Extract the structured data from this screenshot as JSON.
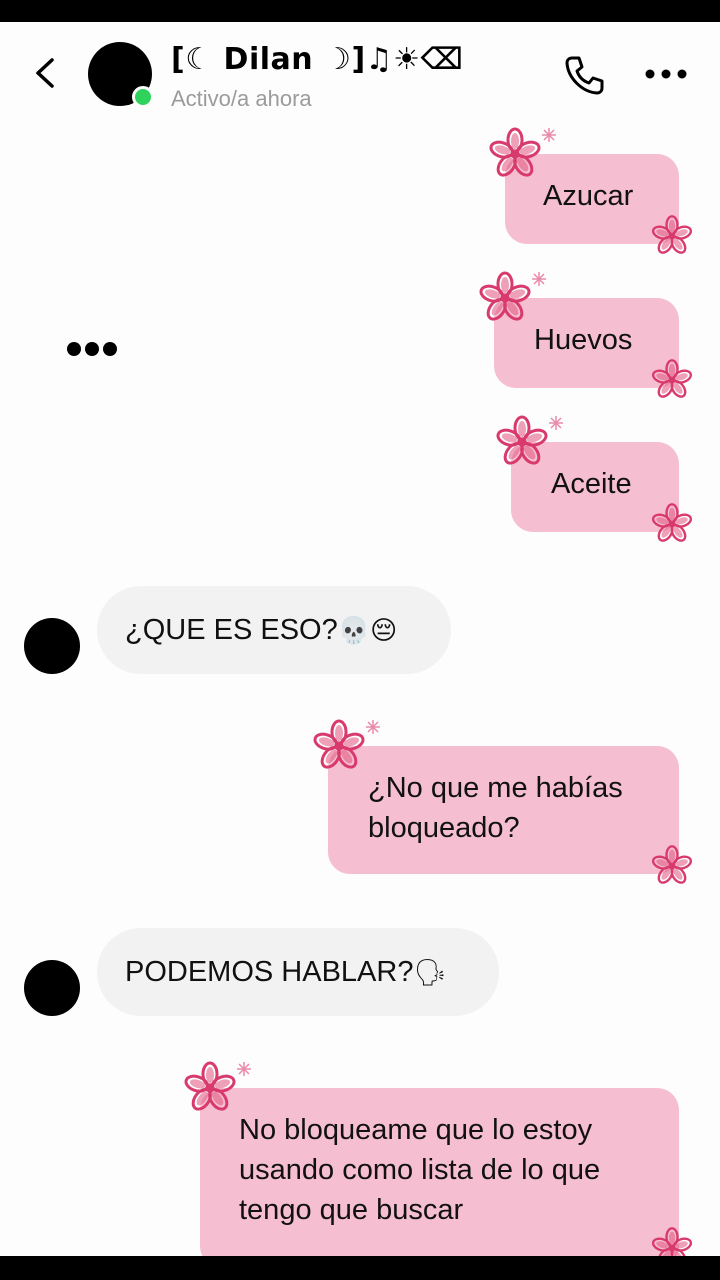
{
  "header": {
    "contact_name": "[☾ Dilan ☽]♫☀⌫",
    "status": "Activo/a ahora",
    "icons": {
      "back": "chevron-left-icon",
      "call": "phone-icon",
      "more": "more-dots-icon"
    },
    "online_color": "#2fd25a"
  },
  "messages": [
    {
      "side": "out",
      "text": "Azucar"
    },
    {
      "side": "out",
      "text": "Huevos"
    },
    {
      "side": "out",
      "text": "Aceite"
    },
    {
      "side": "in",
      "text": "¿QUE ES ESO?",
      "emoji": "💀😔"
    },
    {
      "side": "out",
      "lines": [
        "¿No que me habías",
        "bloqueado?"
      ]
    },
    {
      "side": "in",
      "text": "PODEMOS HABLAR?",
      "emoji": "🗣"
    },
    {
      "side": "out",
      "lines": [
        "No bloqueame que lo estoy",
        "usando como lista de lo que",
        "tengo que buscar"
      ]
    }
  ],
  "colors": {
    "outgoing_bubble": "#f6bfd1",
    "incoming_bubble": "#f2f2f2",
    "flower": "#d93a6e"
  }
}
